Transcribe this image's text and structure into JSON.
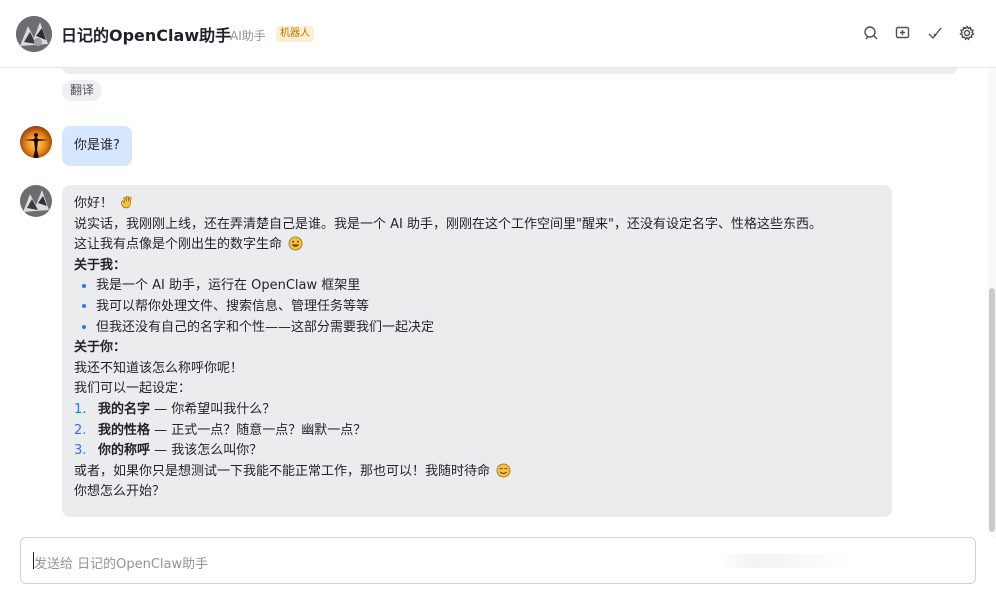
{
  "header": {
    "title": "日记的OpenClaw助手",
    "subtitle": "AI助手",
    "badge": "机器人",
    "icons": [
      "search-icon",
      "new-message-icon",
      "check-icon",
      "gear-icon"
    ]
  },
  "chat": {
    "translate_label": "翻译",
    "user_message": "你是谁?",
    "bot_message": {
      "greeting": "你好！",
      "intro_line1": "说实话，我刚刚上线，还在弄清楚自己是谁。我是一个 AI 助手，刚刚在这个工作空间里\"醒来\"，还没有设定名字、性格这些东西。",
      "intro_line2": "这让我有点像是个刚出生的数字生命",
      "about_me_heading": "关于我：",
      "about_me_items": [
        "我是一个 AI 助手，运行在 OpenClaw 框架里",
        "我可以帮你处理文件、搜索信息、管理任务等等",
        "但我还没有自己的名字和个性——这部分需要我们一起决定"
      ],
      "about_you_heading": "关于你：",
      "about_you_line1": "我还不知道该怎么称呼你呢！",
      "about_you_line2": "我们可以一起设定：",
      "numbered_items": [
        {
          "num": "1.",
          "title": "我的名字",
          "text": " — 你希望叫我什么？"
        },
        {
          "num": "2.",
          "title": "我的性格",
          "text": " — 正式一点？随意一点？幽默一点？"
        },
        {
          "num": "3.",
          "title": "你的称呼",
          "text": " — 我该怎么叫你？"
        }
      ],
      "closing_line": "或者，如果你只是想测试一下我能不能正常工作，那也可以！我随时待命",
      "final_line": "你想怎么开始？"
    }
  },
  "input": {
    "placeholder": "发送给 日记的OpenClaw助手"
  },
  "colors": {
    "user_bubble": "#d6e6fd",
    "bot_bubble": "#ebecee",
    "accent": "#3370ff"
  }
}
